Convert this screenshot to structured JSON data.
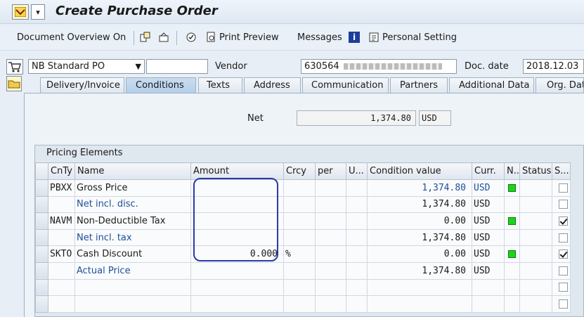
{
  "title": "Create Purchase Order",
  "toolbar": {
    "document_overview": "Document Overview On",
    "print_preview": "Print Preview",
    "messages": "Messages",
    "personal_setting": "Personal Setting"
  },
  "header": {
    "po_type": "NB Standard PO",
    "po_number": "",
    "vendor_label": "Vendor",
    "vendor_value": "630564 ",
    "doc_date_label": "Doc. date",
    "doc_date_value": "2018.12.03"
  },
  "tabs": [
    "Delivery/Invoice",
    "Conditions",
    "Texts",
    "Address",
    "Communication",
    "Partners",
    "Additional Data",
    "Org. Data"
  ],
  "active_tab": "Conditions",
  "net": {
    "label": "Net",
    "value": "1,374.80",
    "currency": "USD"
  },
  "pricing": {
    "title": "Pricing Elements",
    "columns": [
      "CnTy",
      "Name",
      "Amount",
      "Crcy",
      "per",
      "U...",
      "Condition value",
      "Curr.",
      "N..",
      "Status",
      "S..."
    ],
    "rows": [
      {
        "cnty": "PBXX",
        "name": "Gross Price",
        "amount": "",
        "crcy": "",
        "value": "1,374.80",
        "curr": "USD",
        "n": true,
        "s": false,
        "link": false,
        "value_link": true
      },
      {
        "cnty": "",
        "name": "Net incl. disc.",
        "amount": "",
        "crcy": "",
        "value": "1,374.80",
        "curr": "USD",
        "n": false,
        "s": false,
        "link": true,
        "value_link": false
      },
      {
        "cnty": "NAVM",
        "name": "Non-Deductible Tax",
        "amount": "",
        "crcy": "",
        "value": "0.00",
        "curr": "USD",
        "n": true,
        "s": true,
        "link": false,
        "value_link": false
      },
      {
        "cnty": "",
        "name": "Net incl. tax",
        "amount": "",
        "crcy": "",
        "value": "1,374.80",
        "curr": "USD",
        "n": false,
        "s": false,
        "link": true,
        "value_link": false
      },
      {
        "cnty": "SKTO",
        "name": "Cash Discount",
        "amount": "0.000",
        "crcy": "%",
        "value": "0.00",
        "curr": "USD",
        "n": true,
        "s": true,
        "link": false,
        "value_link": false
      },
      {
        "cnty": "",
        "name": "Actual Price",
        "amount": "",
        "crcy": "",
        "value": "1,374.80",
        "curr": "USD",
        "n": false,
        "s": false,
        "link": true,
        "value_link": false
      },
      {
        "cnty": "",
        "name": "",
        "amount": "",
        "crcy": "",
        "value": "",
        "curr": "",
        "n": false,
        "s": false,
        "link": false,
        "value_link": false,
        "blank": true
      },
      {
        "cnty": "",
        "name": "",
        "amount": "",
        "crcy": "",
        "value": "",
        "curr": "",
        "n": false,
        "s": false,
        "link": false,
        "value_link": false,
        "blank": true
      }
    ]
  }
}
